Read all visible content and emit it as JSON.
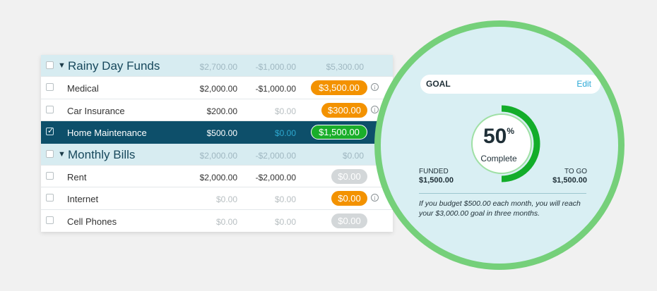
{
  "table": {
    "rows": [
      {
        "type": "group",
        "name": "Rainy Day Funds",
        "c1": "$2,700.00",
        "c2": "-$1,000.00",
        "c3": "$5,300.00"
      },
      {
        "type": "item",
        "name": "Medical",
        "budgeted": "$2,000.00",
        "activity": "-$1,000.00",
        "available": "$3,500.00",
        "pill_color": "orange",
        "info": "i"
      },
      {
        "type": "item",
        "name": "Car Insurance",
        "budgeted": "$200.00",
        "activity": "$0.00",
        "available": "$300.00",
        "pill_color": "orange",
        "info": "i"
      },
      {
        "type": "item",
        "name": "Home Maintenance",
        "budgeted": "$500.00",
        "activity": "$0.00",
        "available": "$1,500.00",
        "pill_color": "green",
        "selected": true,
        "check": "✓"
      },
      {
        "type": "group",
        "name": "Monthly Bills",
        "c1": "$2,000.00",
        "c2": "-$2,000.00",
        "c3": "$0.00"
      },
      {
        "type": "item",
        "name": "Rent",
        "budgeted": "$2,000.00",
        "activity": "-$2,000.00",
        "available": "$0.00",
        "pill_color": "gray"
      },
      {
        "type": "item",
        "name": "Internet",
        "budgeted": "$0.00",
        "activity": "$0.00",
        "available": "$0.00",
        "pill_color": "orange",
        "info": "i"
      },
      {
        "type": "item",
        "name": "Cell Phones",
        "budgeted": "$0.00",
        "activity": "$0.00",
        "available": "$0.00",
        "pill_color": "gray"
      }
    ]
  },
  "goal": {
    "label": "GOAL",
    "edit": "Edit",
    "percent": "50",
    "percent_sign": "%",
    "percent_value": 0.5,
    "complete": "Complete",
    "funded_label": "FUNDED",
    "funded_value": "$1,500.00",
    "togo_label": "TO GO",
    "togo_value": "$1,500.00",
    "note": "If you budget $500.00 each month, you will reach your $3,000.00 goal in three months."
  },
  "colors": {
    "selected_row": "#0d4f6a",
    "group_row": "#d7ecf1",
    "pill_orange": "#f39200",
    "pill_green": "#1aae2a",
    "pill_gray": "#d3d7d9",
    "ring_green": "#13ad2a",
    "lens_border": "#75d07a",
    "edit_link": "#2aa8d6"
  },
  "icons": {
    "caret": "▼",
    "info": "info-circle-icon",
    "checkbox": "checkbox-icon"
  }
}
